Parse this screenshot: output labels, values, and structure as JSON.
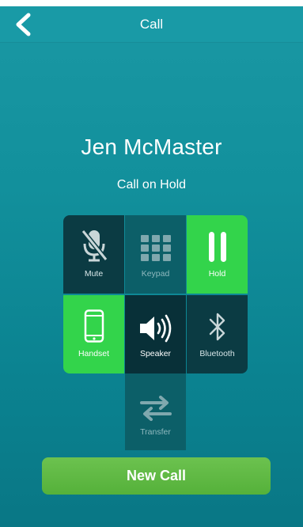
{
  "nav": {
    "title": "Call",
    "back_icon": "chevron-left-icon"
  },
  "call": {
    "caller_name": "Jen McMaster",
    "status": "Call on Hold"
  },
  "controls": [
    {
      "label": "Mute",
      "icon": "mic-muted-icon",
      "state": "off"
    },
    {
      "label": "Keypad",
      "icon": "keypad-icon",
      "state": "disabled"
    },
    {
      "label": "Hold",
      "icon": "pause-icon",
      "state": "active"
    },
    {
      "label": "Handset",
      "icon": "phone-handset-icon",
      "state": "active"
    },
    {
      "label": "Speaker",
      "icon": "speaker-icon",
      "state": "off"
    },
    {
      "label": "Bluetooth",
      "icon": "bluetooth-icon",
      "state": "off"
    },
    {
      "label": "Transfer",
      "icon": "transfer-arrows-icon",
      "state": "disabled"
    }
  ],
  "actions": {
    "new_call_label": "New Call"
  },
  "colors": {
    "active_green": "#33d44b",
    "button_green": "#55b13a",
    "tile_dark": "#0b3b43",
    "background_teal": "#12909c"
  }
}
